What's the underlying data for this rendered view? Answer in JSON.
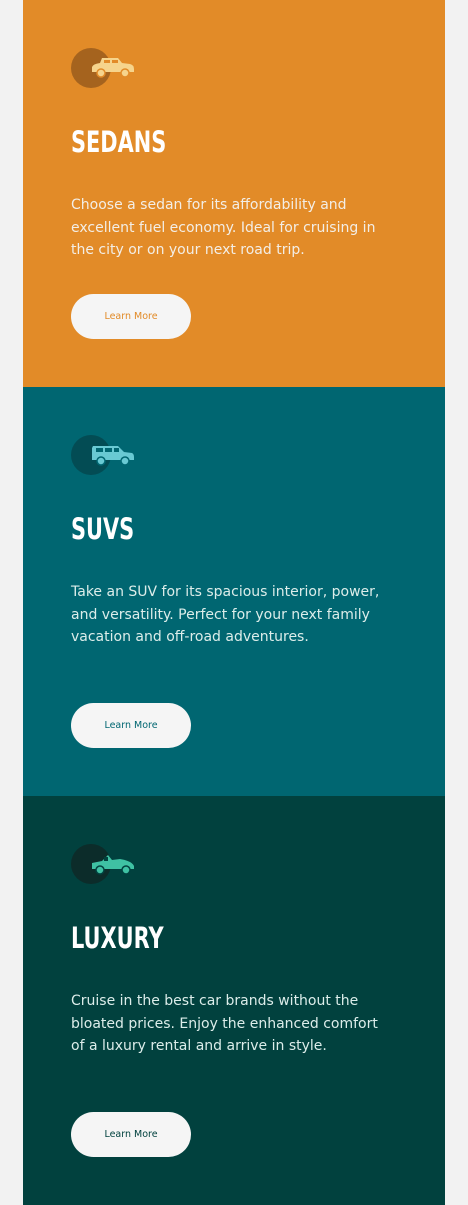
{
  "cards": [
    {
      "title": "SEDANS",
      "description": "Choose a sedan for its affordability and excellent fuel economy. Ideal for cruising in the city or on your next road trip.",
      "button_label": "Learn More",
      "icon": "sedan-car-icon",
      "background": "#e28b28"
    },
    {
      "title": "SUVS",
      "description": "Take an SUV for its spacious interior, power, and versatility. Perfect for your next family vacation and off-road adventures.",
      "button_label": "Learn More",
      "icon": "suv-car-icon",
      "background": "#006671"
    },
    {
      "title": "LUXURY",
      "description": "Cruise in the best car brands without the bloated prices. Enjoy the enhanced comfort of a luxury rental and arrive in style.",
      "button_label": "Learn More",
      "icon": "luxury-car-icon",
      "background": "#01413e"
    }
  ]
}
